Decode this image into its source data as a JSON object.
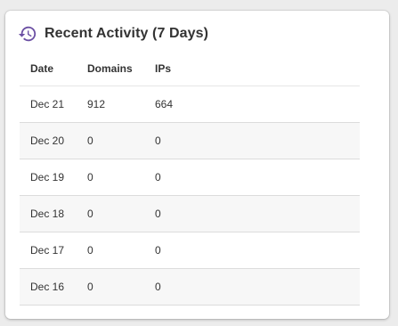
{
  "card": {
    "title": "Recent Activity (7 Days)",
    "icon": "history-icon"
  },
  "table": {
    "columns": [
      "Date",
      "Domains",
      "IPs"
    ],
    "rows": [
      {
        "date": "Dec 21",
        "domains": "912",
        "ips": "664"
      },
      {
        "date": "Dec 20",
        "domains": "0",
        "ips": "0"
      },
      {
        "date": "Dec 19",
        "domains": "0",
        "ips": "0"
      },
      {
        "date": "Dec 18",
        "domains": "0",
        "ips": "0"
      },
      {
        "date": "Dec 17",
        "domains": "0",
        "ips": "0"
      },
      {
        "date": "Dec 16",
        "domains": "0",
        "ips": "0"
      }
    ]
  },
  "colors": {
    "accent": "#6b4fa3"
  }
}
